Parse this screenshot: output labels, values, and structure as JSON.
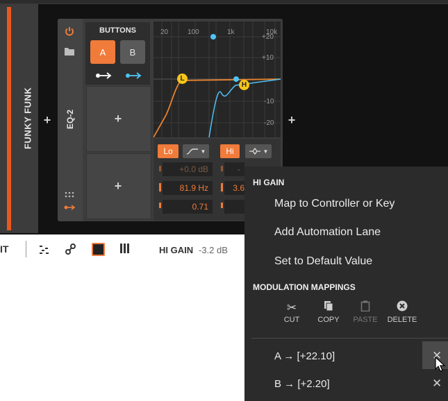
{
  "track": {
    "name": "FUNKY FUNK"
  },
  "device": {
    "name": "EQ-2",
    "buttons_title": "BUTTONS",
    "btn_a": "A",
    "btn_b": "B",
    "graph": {
      "freq_labels": [
        "20",
        "100",
        "1k",
        "10k"
      ],
      "db_labels": [
        "+20",
        "+10",
        "-10",
        "-20"
      ],
      "node_l": "L",
      "node_h": "H"
    },
    "bands": {
      "lo_label": "Lo",
      "hi_label": "Hi",
      "lo_gain": "+0.0 dB",
      "lo_freq": "81.9 Hz",
      "lo_q": "0.71",
      "hi_gain": "-",
      "hi_freq": "3.6"
    }
  },
  "toolbar": {
    "partial_label": "IT",
    "param_name": "HI GAIN",
    "param_value": "-3.2 dB"
  },
  "context_menu": {
    "header": "HI GAIN",
    "items": [
      "Map to Controller or Key",
      "Add Automation Lane",
      "Set to Default Value"
    ],
    "mod_header": "MODULATION MAPPINGS",
    "mod_buttons": [
      {
        "label": "CUT",
        "icon": "scissors-icon"
      },
      {
        "label": "COPY",
        "icon": "copy-icon"
      },
      {
        "label": "PASTE",
        "icon": "paste-icon",
        "enabled": false
      },
      {
        "label": "DELETE",
        "icon": "delete-icon"
      }
    ],
    "mappings": [
      "A → [+22.10]",
      "B → [+2.20]"
    ]
  },
  "colors": {
    "accent": "#f07b3a",
    "blue": "#4fc3f7",
    "yellow": "#f5c518",
    "track": "#e8581c"
  }
}
